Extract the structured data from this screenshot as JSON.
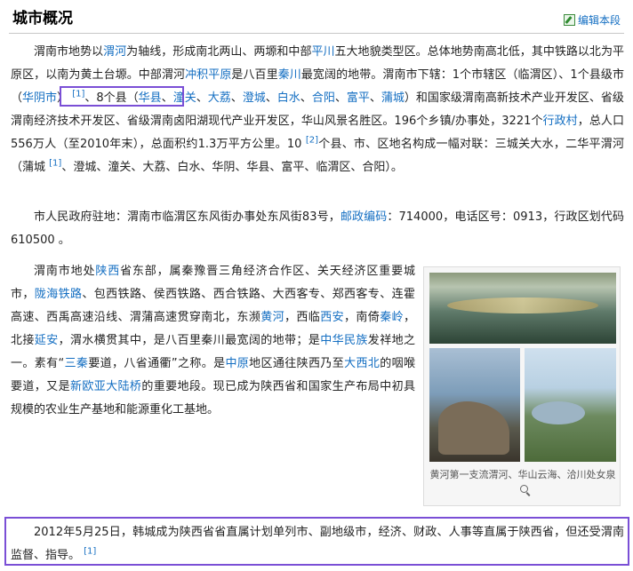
{
  "section": {
    "title": "城市概况",
    "edit_label": "编辑本段"
  },
  "p1": {
    "t1": "渭南市地势以",
    "l1": "渭河",
    "t2": "为轴线，形成南北两山、两塬和中部",
    "l2": "平川",
    "t3": "五大地貌类型区。总体地势南高北低，其中铁路以北为平原区，以南为黄土台塬。中部渭河",
    "l3": "冲积平原",
    "t4": "是八百里",
    "l4": "秦川",
    "t5": "最宽阔的地带。渭南市下辖：1个市辖区（临渭区）、",
    "t6": "1个县级市（",
    "l5": "华阴市",
    "t7": "）",
    "sup1": "[1]",
    "t8": "、8个县（",
    "c1": "华县",
    "c2": "潼关",
    "c3": "大荔",
    "c4": "澄城",
    "c5": "白水",
    "c6": "合阳",
    "c7": "富平",
    "c8": "蒲城",
    "sep": "、",
    "t9": "）和国家级渭南高新技术产业开发区、省级渭南经济技术开发区、省级渭南卤阳湖现代产业开发区，华山风景名胜区。196个乡镇/办事处，3221个",
    "l6": "行政村",
    "t10": "，总人口556万人（至2010年末），总面积约1.3万平方公里。10 ",
    "sup2": "[2]",
    "t11": "个县、市、区地名构成一幅对联：三城关大水，二华平渭河（蒲城 ",
    "sup3": "[1]",
    "t12": "、澄城、潼关、大荔、白水、华阴、华县、富平、临渭区、合阳）。"
  },
  "p2": {
    "t1": "市人民政府驻地：渭南市临渭区东风街办事处东风街83号，",
    "l1": "邮政编码",
    "t2": "：714000，电话区号：0913，行政区划代码610500 。"
  },
  "p3": {
    "t1": "渭南市地处",
    "l1": "陕西",
    "t2": "省东部，属秦豫晋三角经济合作区、关天经济区重要城市，",
    "l2": "陇海铁路",
    "t3": "、包西铁路、侯西铁路、西合铁路、大西客专、郑西客专、连霍高速、西禹高速沿线、渭蒲高速贯穿南北，东濒",
    "l3": "黄河",
    "t4": "，西临",
    "l4": "西安",
    "t5": "，南倚",
    "l5": "秦岭",
    "t6": "，北接",
    "l6": "延安",
    "t7": "，渭水横贯其中，是八百里秦川最宽阔的地带；是",
    "l7": "中华民族",
    "t8": "发祥地之一。素有“",
    "l8": "三秦",
    "t9": "要道，八省通衢”之称。是",
    "l9": "中原",
    "t10": "地区通往陕西乃至",
    "l10": "大西北",
    "t11": "的咽喉要道，又是",
    "l11": "新欧亚大陆桥",
    "t12": "的重要地段。现已成为陕西省和国家生产布局中初具规模的农业生产基地和能源重化工基地。"
  },
  "figure": {
    "caption": "黄河第一支流渭河、华山云海、洽川处女泉"
  },
  "p4": {
    "t1": "2012年5月25日，韩城成为陕西省省直属计划单列市、副地级市，经济、财政、人事等直属于陕西省，但还受渭南监督、指导。",
    "sup": "[1]"
  }
}
